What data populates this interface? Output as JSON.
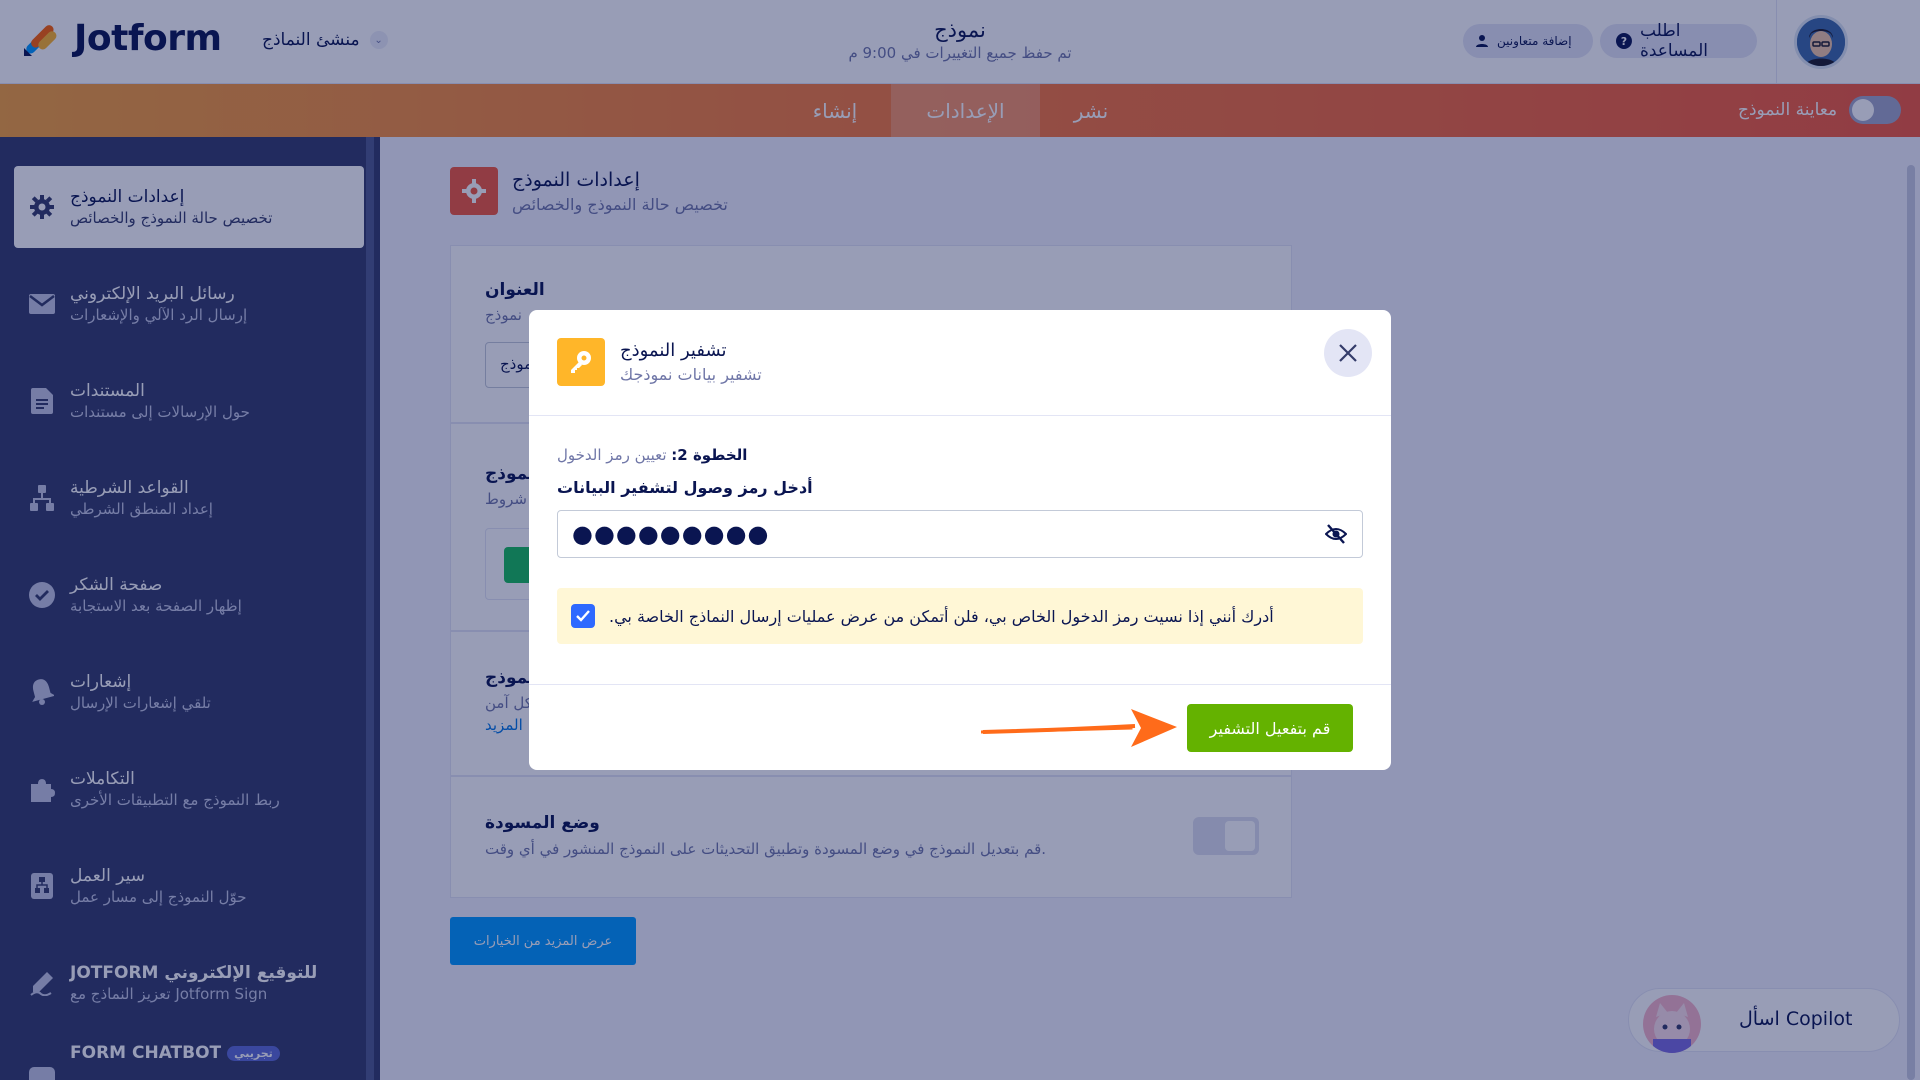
{
  "header": {
    "logo_text": "Jotform",
    "builder_dropdown": "منشئ النماذج",
    "form_title": "نموذج",
    "save_status": "تم حفظ جميع التغييرات في 9:00 م",
    "help_button": "اطلب المساعدة",
    "invite_button": "إضافة متعاونين"
  },
  "nav": {
    "tab_publish": "نشر",
    "tab_settings": "الإعدادات",
    "tab_build": "إنشاء",
    "preview_label": "معاينة النموذج"
  },
  "sidebar": {
    "items": [
      {
        "icon": "gear-icon",
        "title": "إعدادات النموذج",
        "sub": "تخصيص حالة النموذج والخصائص",
        "active": true
      },
      {
        "icon": "envelope-icon",
        "title": "رسائل البريد الإلكتروني",
        "sub": "إرسال الرد الآلي والإشعارات"
      },
      {
        "icon": "document-icon",
        "title": "المستندات",
        "sub": "حول الإرسالات إلى مستندات"
      },
      {
        "icon": "logic-icon",
        "title": "القواعد الشرطية",
        "sub": "إعداد المنطق الشرطي"
      },
      {
        "icon": "check-circle-icon",
        "title": "صفحة الشكر",
        "sub": "إظهار الصفحة بعد الاستجابة"
      },
      {
        "icon": "bell-icon",
        "title": "إشعارات",
        "sub": "تلقي إشعارات الإرسال"
      },
      {
        "icon": "puzzle-icon",
        "title": "التكاملات",
        "sub": "ربط النموذج مع التطبيقات الأخرى"
      },
      {
        "icon": "workflow-icon",
        "title": "سير العمل",
        "sub": "حوّل النموذج إلى مسار عمل"
      },
      {
        "icon": "signature-icon",
        "title": "JOTFORM للتوقيع الإلكتروني",
        "sub": "تعزيز النماذج مع Jotform Sign"
      },
      {
        "icon": "chatbot-icon",
        "title": "FORM CHATBOT",
        "sub": "",
        "badge": "تجريبي"
      }
    ]
  },
  "main": {
    "section_title": "إعدادات النموذج",
    "section_sub": "تخصيص حالة النموذج والخصائص",
    "title_card_label": "العنوان",
    "title_card_desc": "نموذج",
    "title_input_value": "نموذج",
    "status_card_label": "نموذج",
    "status_card_desc": "شروط",
    "encrypt_card_label": "نموذج",
    "encrypt_card_desc": "كل آمن",
    "encrypt_card_link": "المزيد",
    "draft_label": "وضع المسودة",
    "draft_desc": "قم بتعديل النموذج في وضع المسودة وتطبيق التحديثات على النموذج المنشور في أي وقت.",
    "more_options_button": "عرض المزيد من الخيارات"
  },
  "modal": {
    "title": "تشفير النموذج",
    "subtitle": "تشفير بيانات نموذجك",
    "step_prefix": "الخطوة 2:",
    "step_text": "تعيين رمز الدخول",
    "password_label": "أدخل رمز وصول لتشفير البيانات",
    "password_value": "●●●●●●●●●",
    "acknowledge_text": ".أدرك أنني إذا نسيت رمز الدخول الخاص بي، فلن أتمكن من عرض عمليات إرسال النماذج الخاصة بي",
    "acknowledge_checked": true,
    "activate_button": "قم بتفعيل التشفير"
  },
  "copilot": {
    "label": "اسأل Copilot"
  },
  "colors": {
    "brand_navy": "#0a1551",
    "sidebar_bg": "#343c6a",
    "accent_orange": "#f77e3b",
    "settings_red": "#f3593c",
    "key_yellow": "#ffb629",
    "activate_green": "#64b200",
    "checkbox_blue": "#2e69ff",
    "warning_bg": "#fff7d6"
  }
}
